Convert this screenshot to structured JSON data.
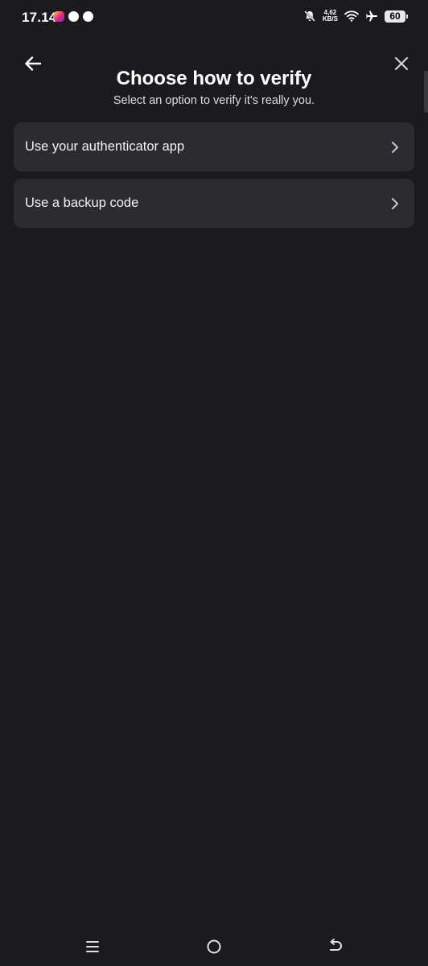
{
  "status_bar": {
    "time": "17.14",
    "network_speed_value": "4,62",
    "network_speed_unit": "KB/S",
    "battery": "60",
    "notification_icons": [
      "instagram-icon",
      "shield-app-icon",
      "chat-app-icon"
    ],
    "system_icons": [
      "bell-off-icon",
      "wifi-icon",
      "airplane-icon",
      "battery-icon"
    ]
  },
  "header": {
    "title": "Choose how to verify",
    "subtitle": "Select an option to verify it's really you.",
    "back_icon": "arrow-left-icon",
    "close_icon": "close-icon"
  },
  "options": [
    {
      "label": "Use your authenticator app",
      "icon": "chevron-right-icon"
    },
    {
      "label": "Use a backup code",
      "icon": "chevron-right-icon"
    }
  ],
  "nav_bar": {
    "icons": [
      "recent-apps-icon",
      "home-icon",
      "back-icon"
    ]
  },
  "colors": {
    "background": "#1b1b1f",
    "card": "#2b2b30",
    "text_primary": "#f2f3f5",
    "text_secondary": "#dbdee1"
  }
}
